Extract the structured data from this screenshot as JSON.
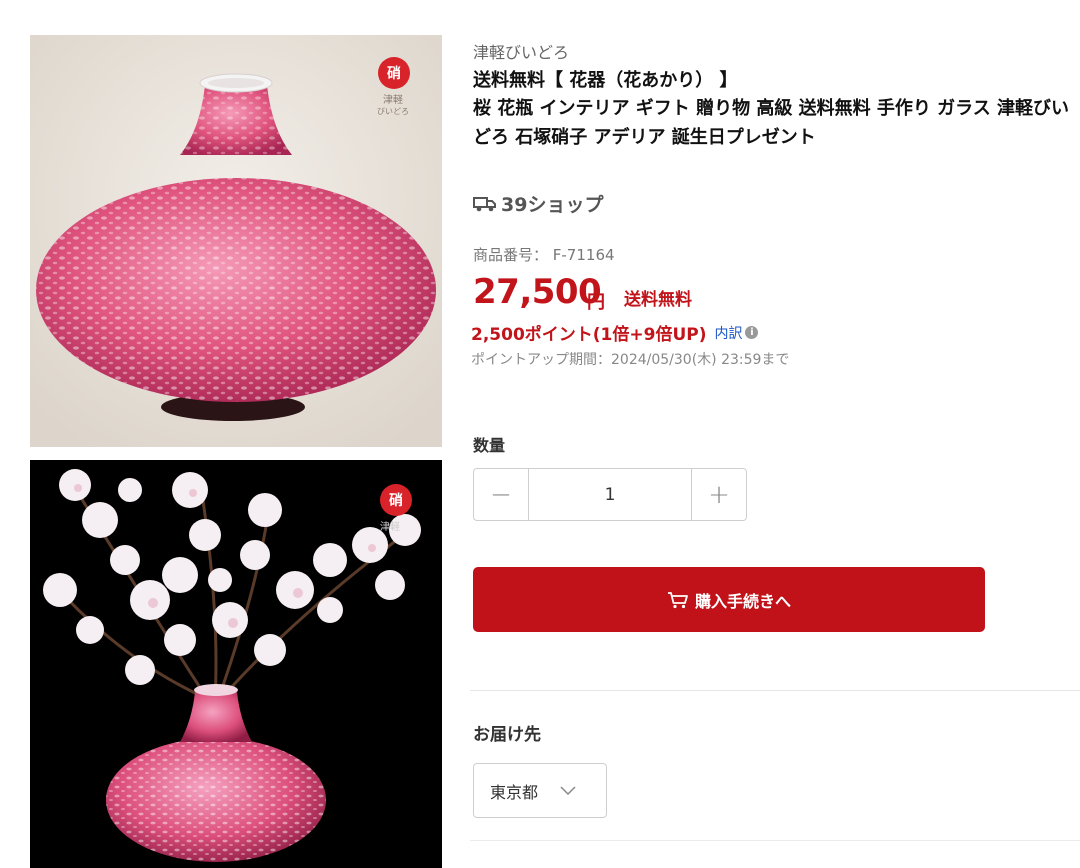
{
  "images": {
    "logo_mark": "硝",
    "logo_text_1": "津軽",
    "logo_text_2": "びいどろ",
    "logo2_text": "津軽"
  },
  "product": {
    "brand": "津軽びいどろ",
    "title_line1": "送料無料【 花器（花あかり） 】",
    "title_line2": "桜 花瓶 インテリア ギフト 贈り物 高級 送料無料 手作り ガラス 津軽びいどろ 石塚硝子 アデリア 誕生日プレゼント",
    "shop_name": "39ショップ",
    "item_number": "商品番号： F-71164",
    "price": "27,500",
    "currency": "円",
    "shipping": "送料無料",
    "points": "2,500ポイント(1倍+9倍UP)",
    "points_detail": "内訳",
    "points_period": "ポイントアップ期間：2024/05/30(木) 23:59まで"
  },
  "quantity": {
    "label": "数量",
    "minus": "−",
    "value": "1",
    "plus": "+"
  },
  "purchase": {
    "button_label": "購入手続きへ"
  },
  "delivery": {
    "label": "お届け先",
    "selected": "東京都"
  },
  "colors": {
    "accent_red": "#c1121a",
    "link_blue": "#1a56c4"
  }
}
